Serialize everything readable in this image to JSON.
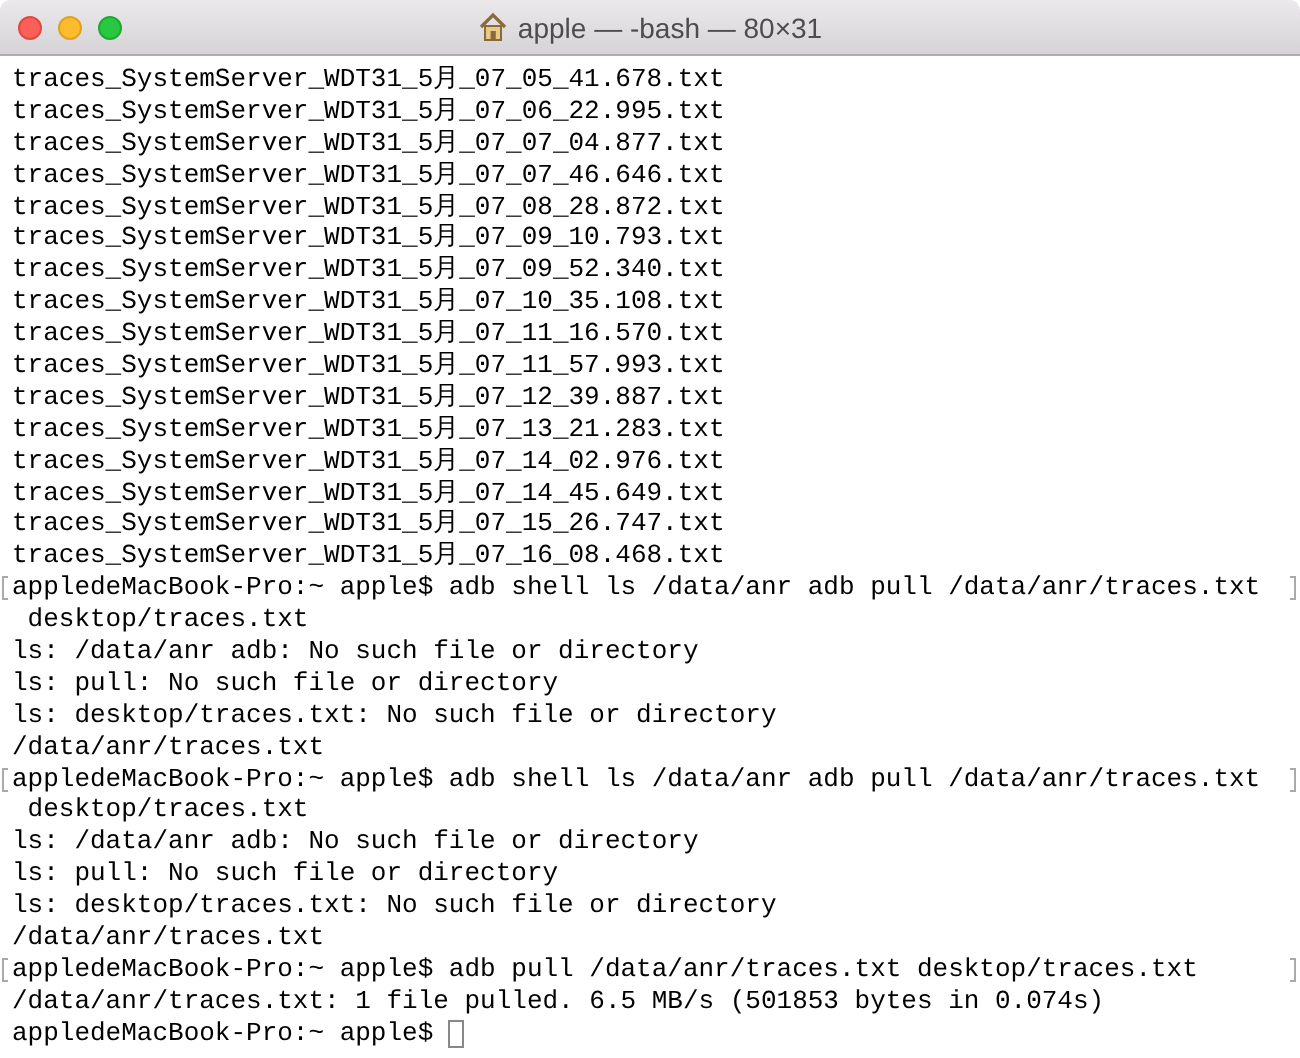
{
  "window": {
    "title": "apple — -bash — 80×31"
  },
  "lines": [
    {
      "kind": "output",
      "text": "traces_SystemServer_WDT31_5月_07_05_41.678.txt"
    },
    {
      "kind": "output",
      "text": "traces_SystemServer_WDT31_5月_07_06_22.995.txt"
    },
    {
      "kind": "output",
      "text": "traces_SystemServer_WDT31_5月_07_07_04.877.txt"
    },
    {
      "kind": "output",
      "text": "traces_SystemServer_WDT31_5月_07_07_46.646.txt"
    },
    {
      "kind": "output",
      "text": "traces_SystemServer_WDT31_5月_07_08_28.872.txt"
    },
    {
      "kind": "output",
      "text": "traces_SystemServer_WDT31_5月_07_09_10.793.txt"
    },
    {
      "kind": "output",
      "text": "traces_SystemServer_WDT31_5月_07_09_52.340.txt"
    },
    {
      "kind": "output",
      "text": "traces_SystemServer_WDT31_5月_07_10_35.108.txt"
    },
    {
      "kind": "output",
      "text": "traces_SystemServer_WDT31_5月_07_11_16.570.txt"
    },
    {
      "kind": "output",
      "text": "traces_SystemServer_WDT31_5月_07_11_57.993.txt"
    },
    {
      "kind": "output",
      "text": "traces_SystemServer_WDT31_5月_07_12_39.887.txt"
    },
    {
      "kind": "output",
      "text": "traces_SystemServer_WDT31_5月_07_13_21.283.txt"
    },
    {
      "kind": "output",
      "text": "traces_SystemServer_WDT31_5月_07_14_02.976.txt"
    },
    {
      "kind": "output",
      "text": "traces_SystemServer_WDT31_5月_07_14_45.649.txt"
    },
    {
      "kind": "output",
      "text": "traces_SystemServer_WDT31_5月_07_15_26.747.txt"
    },
    {
      "kind": "output",
      "text": "traces_SystemServer_WDT31_5月_07_16_08.468.txt"
    },
    {
      "kind": "command",
      "text": "appledeMacBook-Pro:~ apple$ adb shell ls /data/anr adb pull /data/anr/traces.txt"
    },
    {
      "kind": "output",
      "text": " desktop/traces.txt"
    },
    {
      "kind": "output",
      "text": "ls: /data/anr adb: No such file or directory"
    },
    {
      "kind": "output",
      "text": "ls: pull: No such file or directory"
    },
    {
      "kind": "output",
      "text": "ls: desktop/traces.txt: No such file or directory"
    },
    {
      "kind": "output",
      "text": "/data/anr/traces.txt"
    },
    {
      "kind": "command",
      "text": "appledeMacBook-Pro:~ apple$ adb shell ls /data/anr adb pull /data/anr/traces.txt"
    },
    {
      "kind": "output",
      "text": " desktop/traces.txt"
    },
    {
      "kind": "output",
      "text": "ls: /data/anr adb: No such file or directory"
    },
    {
      "kind": "output",
      "text": "ls: pull: No such file or directory"
    },
    {
      "kind": "output",
      "text": "ls: desktop/traces.txt: No such file or directory"
    },
    {
      "kind": "output",
      "text": "/data/anr/traces.txt"
    },
    {
      "kind": "command",
      "text": "appledeMacBook-Pro:~ apple$ adb pull /data/anr/traces.txt desktop/traces.txt"
    },
    {
      "kind": "output",
      "text": "/data/anr/traces.txt: 1 file pulled. 6.5 MB/s (501853 bytes in 0.074s)"
    },
    {
      "kind": "input",
      "text": "appledeMacBook-Pro:~ apple$ "
    }
  ]
}
